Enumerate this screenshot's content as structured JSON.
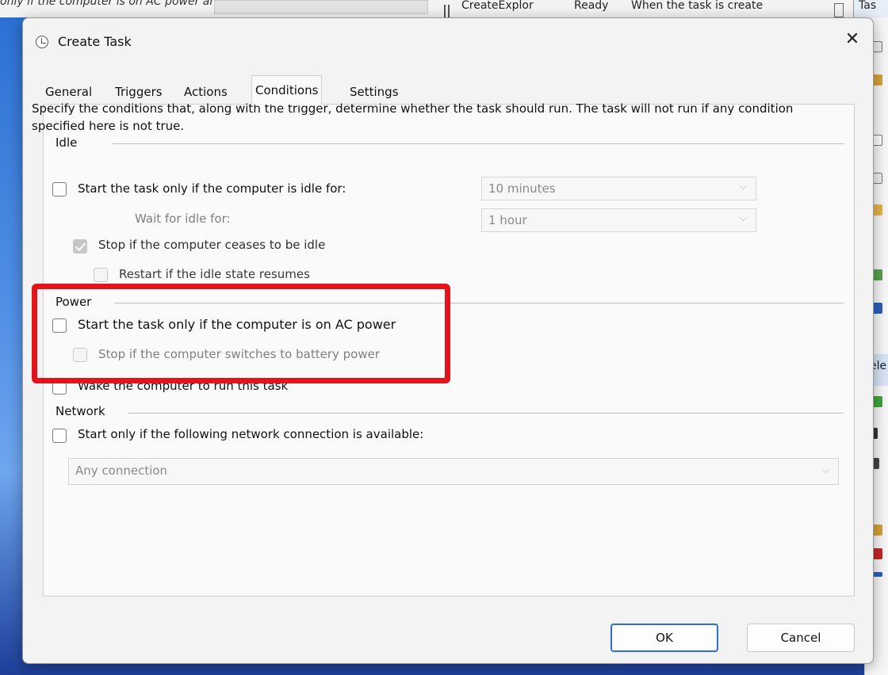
{
  "background": {
    "top_left_text": "only if the computer is on AC power and",
    "top_cells": [
      "CreateExplor",
      "Ready",
      "When the task is create"
    ],
    "top_right_text": "Tas",
    "right_partial_text": "ele"
  },
  "dialog": {
    "title": "Create Task",
    "close_glyph": "✕",
    "tabs": [
      "General",
      "Triggers",
      "Actions",
      "Conditions",
      "Settings"
    ],
    "active_tab": "Conditions",
    "description": "Specify the conditions that, along with the trigger, determine whether the task should run.  The task will not run  if any condition specified here is not true.",
    "idle": {
      "group_label": "Idle",
      "start_if_idle_label": "Start the task only if the computer is idle for:",
      "idle_for_value": "10 minutes",
      "wait_for_idle_label": "Wait for idle for:",
      "wait_for_idle_value": "1 hour",
      "stop_if_ceases_label": "Stop if the computer ceases to be idle",
      "restart_if_resumes_label": "Restart if the idle state resumes"
    },
    "power": {
      "group_label": "Power",
      "ac_power_label": "Start the task only if the computer is on AC power",
      "battery_label": "Stop if the computer switches to battery power",
      "wake_label": "Wake the computer to run this task"
    },
    "network": {
      "group_label": "Network",
      "network_label": "Start only if the following network connection is available:",
      "connection_value": "Any connection"
    },
    "buttons": {
      "ok": "OK",
      "cancel": "Cancel"
    }
  },
  "colors": {
    "highlight": "#e3141c",
    "accent": "#2a6fd1"
  }
}
